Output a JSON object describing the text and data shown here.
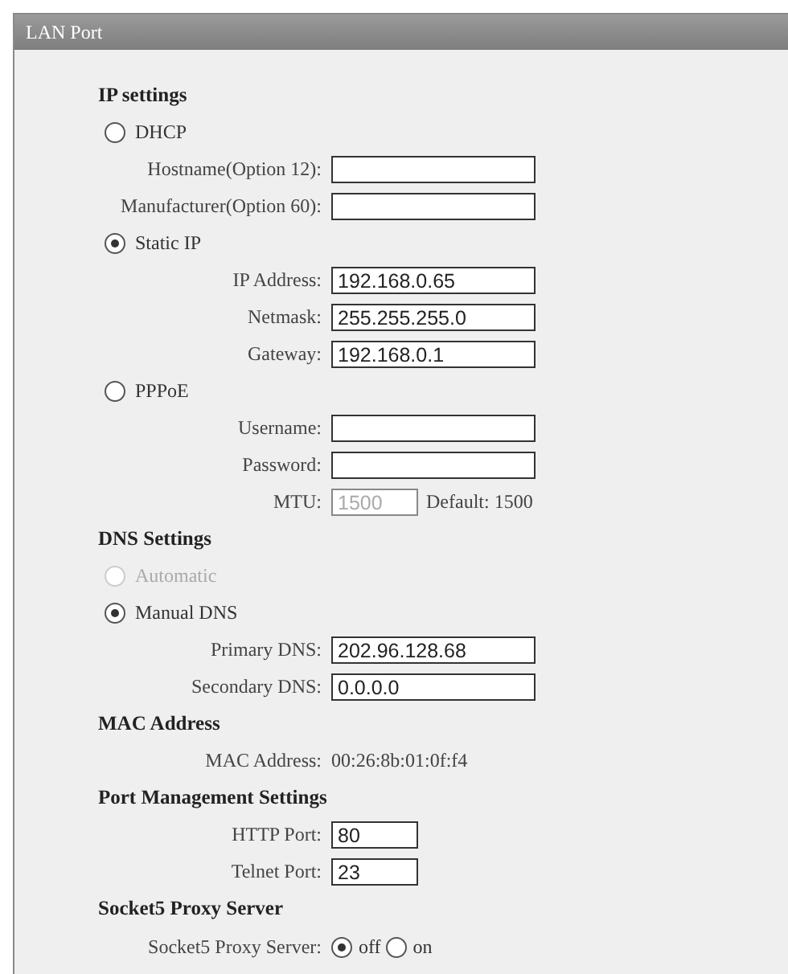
{
  "panel": {
    "title": "LAN Port"
  },
  "rows": [
    {
      "kind": "heading",
      "text": "IP settings"
    },
    {
      "kind": "radio",
      "label": "DHCP",
      "selected": false,
      "disabled": false
    },
    {
      "kind": "field",
      "label": "Hostname(Option 12):",
      "value": "",
      "disabled": false
    },
    {
      "kind": "field",
      "label": "Manufacturer(Option 60):",
      "value": "",
      "disabled": false
    },
    {
      "kind": "radio",
      "label": "Static IP",
      "selected": true,
      "disabled": false
    },
    {
      "kind": "field",
      "label": "IP Address:",
      "value": "192.168.0.65",
      "disabled": false
    },
    {
      "kind": "field",
      "label": "Netmask:",
      "value": "255.255.255.0",
      "disabled": false
    },
    {
      "kind": "field",
      "label": "Gateway:",
      "value": "192.168.0.1",
      "disabled": false
    },
    {
      "kind": "radio",
      "label": "PPPoE",
      "selected": false,
      "disabled": false
    },
    {
      "kind": "field",
      "label": "Username:",
      "value": "",
      "disabled": false
    },
    {
      "kind": "field",
      "label": "Password:",
      "value": "",
      "disabled": false
    },
    {
      "kind": "short_field",
      "label": "MTU:",
      "value": "1500",
      "disabled": true,
      "note": "Default: 1500"
    },
    {
      "kind": "heading",
      "text": "DNS Settings"
    },
    {
      "kind": "radio",
      "label": "Automatic",
      "selected": false,
      "disabled": true
    },
    {
      "kind": "radio",
      "label": "Manual DNS",
      "selected": true,
      "disabled": false
    },
    {
      "kind": "field",
      "label": "Primary DNS:",
      "value": "202.96.128.68",
      "disabled": false
    },
    {
      "kind": "field",
      "label": "Secondary DNS:",
      "value": "0.0.0.0",
      "disabled": false
    },
    {
      "kind": "heading",
      "text": "MAC Address"
    },
    {
      "kind": "info",
      "label": "MAC Address:",
      "value": "00:26:8b:01:0f:f4"
    },
    {
      "kind": "heading",
      "text": "Port Management Settings"
    },
    {
      "kind": "short_field",
      "label": "HTTP Port:",
      "value": "80",
      "disabled": false
    },
    {
      "kind": "short_field",
      "label": "Telnet Port:",
      "value": "23",
      "disabled": false
    },
    {
      "kind": "heading",
      "text": "Socket5 Proxy Server"
    },
    {
      "kind": "choice",
      "label": "Socket5 Proxy Server:",
      "options": [
        {
          "label": "off",
          "selected": true
        },
        {
          "label": "on",
          "selected": false
        }
      ]
    }
  ]
}
